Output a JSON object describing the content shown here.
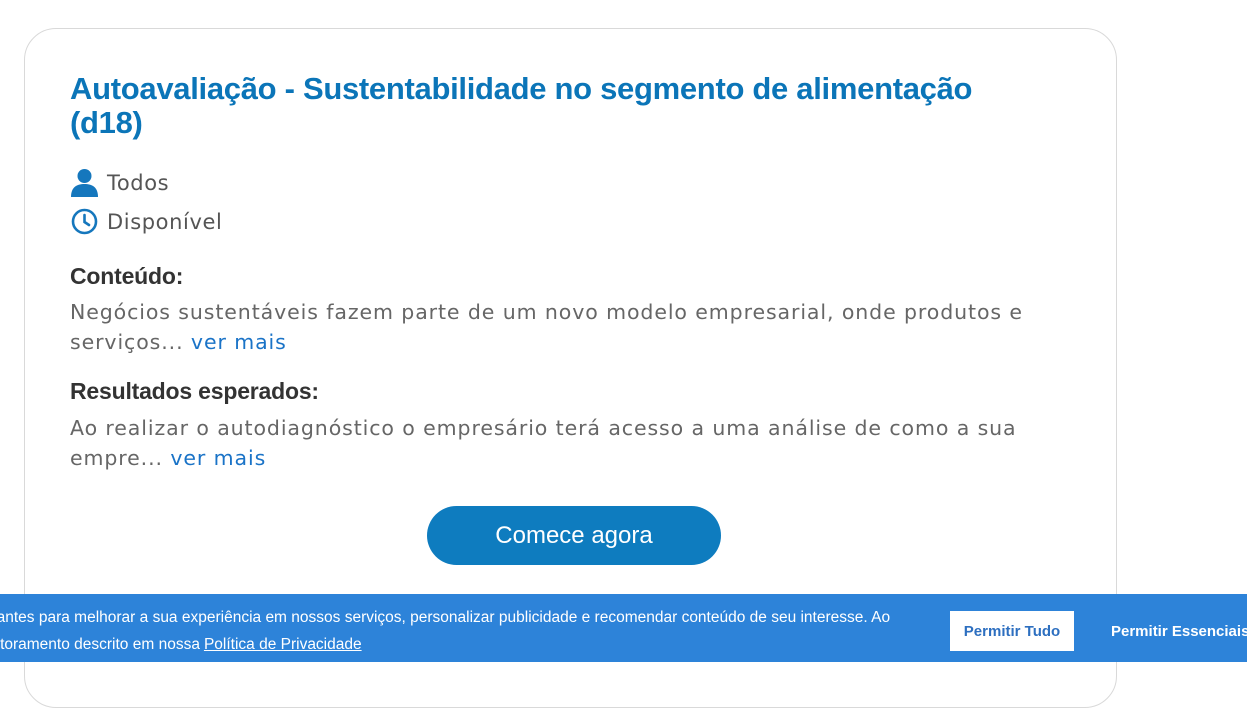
{
  "course": {
    "title": "Autoavaliação - Sustentabilidade no segmento de alimentação (d18)",
    "audience": "Todos",
    "status": "Disponível"
  },
  "content": {
    "heading": "Conteúdo:",
    "text": "Negócios sustentáveis fazem parte de um novo modelo empresarial, onde produtos e serviços...",
    "more_link": "ver mais"
  },
  "results": {
    "heading": "Resultados esperados:",
    "text": "Ao realizar o autodiagnóstico o empresário terá acesso a uma análise de como a sua empre...",
    "more_link": "ver mais"
  },
  "cta": {
    "label": "Comece agora"
  },
  "cookie_banner": {
    "line1": "nantes para melhorar a sua experiência em nossos serviços, personalizar publicidade e recomendar conteúdo de seu interesse. Ao",
    "line2": "nitoramento descrito em nossa",
    "privacy_link": "Política de Privacidade",
    "allow_all_label": "Permitir Tudo",
    "allow_essential_label": "Permitir Essenciais"
  },
  "icons": {
    "audience": "user-icon",
    "status": "clock-icon"
  },
  "colors": {
    "title": "#0b75b8",
    "button": "#0e7cbf",
    "link": "#1a73c7",
    "cookie_bar": "#2d83d9"
  }
}
